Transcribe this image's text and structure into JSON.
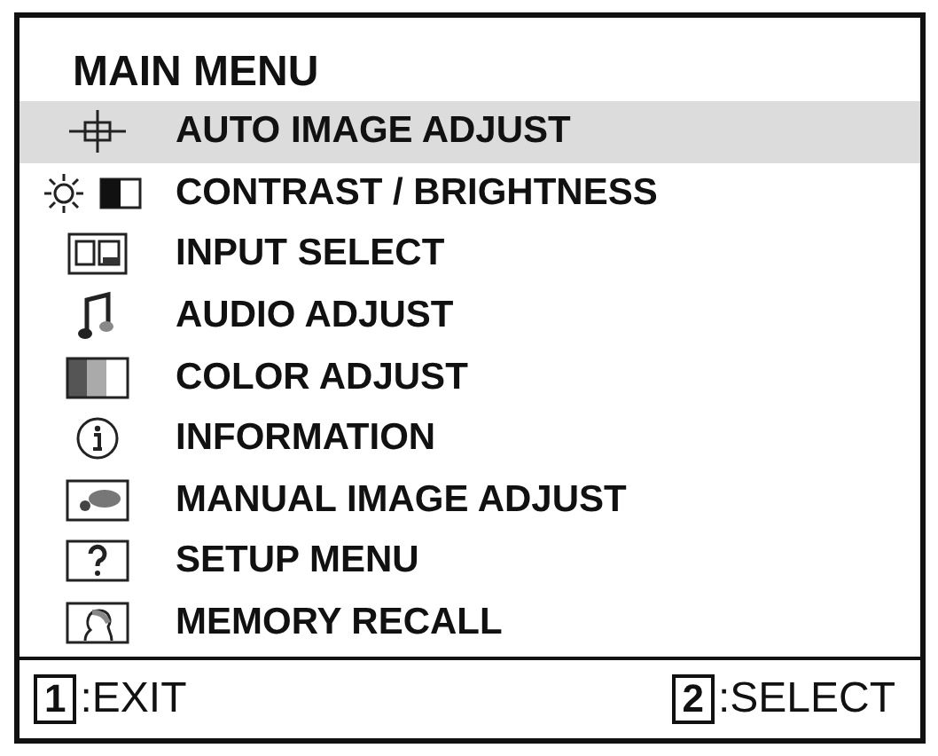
{
  "title": "MAIN MENU",
  "items": [
    {
      "label": "AUTO IMAGE ADJUST",
      "kind": "crosshair",
      "selected": true
    },
    {
      "label": "CONTRAST / BRIGHTNESS",
      "kind": "sun",
      "selected": false
    },
    {
      "label": "INPUT SELECT",
      "kind": "input",
      "selected": false
    },
    {
      "label": "AUDIO ADJUST",
      "kind": "note",
      "selected": false
    },
    {
      "label": "COLOR ADJUST",
      "kind": "color",
      "selected": false
    },
    {
      "label": "INFORMATION",
      "kind": "info",
      "selected": false
    },
    {
      "label": "MANUAL IMAGE ADJUST",
      "kind": "manual",
      "selected": false
    },
    {
      "label": "SETUP MENU",
      "kind": "question",
      "selected": false
    },
    {
      "label": "MEMORY RECALL",
      "kind": "head",
      "selected": false
    }
  ],
  "footer": [
    {
      "key": "1",
      "label": ":EXIT"
    },
    {
      "key": "2",
      "label": ":SELECT"
    }
  ]
}
